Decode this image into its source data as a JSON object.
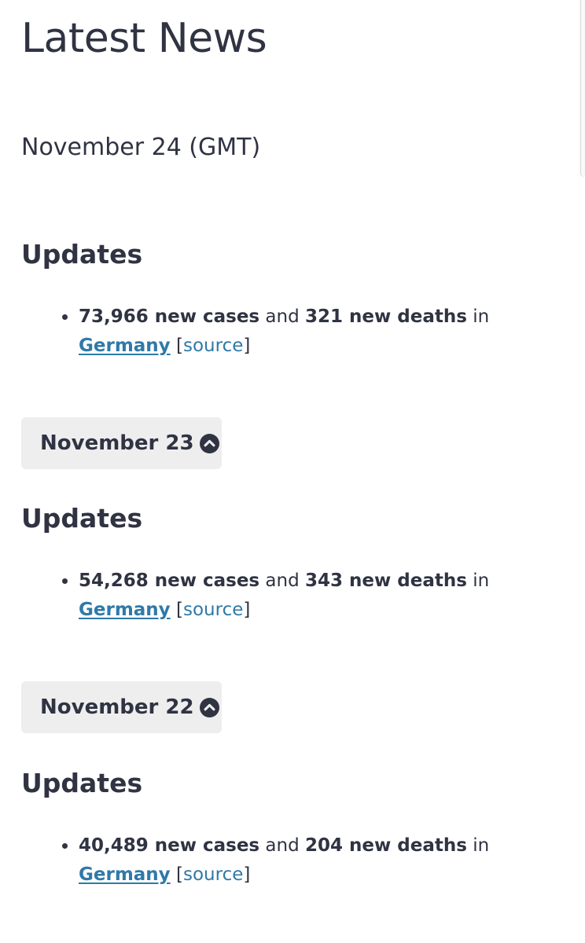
{
  "page": {
    "title": "Latest News",
    "current_date": "November 24 (GMT)"
  },
  "sections": [
    {
      "heading": "Updates",
      "update": {
        "cases": "73,966 new cases",
        "and": " and ",
        "deaths": "321 new deaths",
        "in": " in",
        "country": "Germany",
        "source_open": "[",
        "source": "source",
        "source_close": "]"
      }
    },
    {
      "date_toggle": "November 23",
      "heading": "Updates",
      "update": {
        "cases": "54,268 new cases",
        "and": " and ",
        "deaths": "343 new deaths",
        "in": " in",
        "country": "Germany",
        "source_open": "[",
        "source": "source",
        "source_close": "]"
      }
    },
    {
      "date_toggle": "November 22",
      "heading": "Updates",
      "update": {
        "cases": "40,489 new cases",
        "and": " and ",
        "deaths": "204 new deaths",
        "in": " in",
        "country": "Germany",
        "source_open": "[",
        "source": "source",
        "source_close": "]"
      }
    }
  ],
  "icons": {
    "toggle": "chevron-up-circle-icon"
  },
  "colors": {
    "text": "#2f3342",
    "link": "#2f79a8",
    "toggle_bg": "#eeeeef"
  }
}
